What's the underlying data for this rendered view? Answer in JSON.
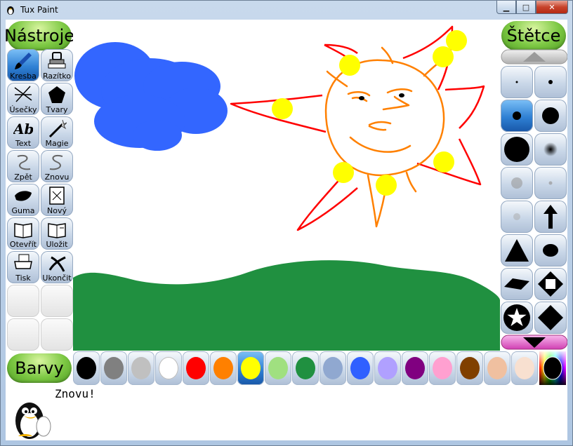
{
  "window": {
    "title": "Tux Paint"
  },
  "headers": {
    "tools": "Nástroje",
    "brushes": "Štětce",
    "colors": "Barvy"
  },
  "tools": [
    {
      "label": "Kresba",
      "icon": "paintbrush-icon",
      "selected": true
    },
    {
      "label": "Razítko",
      "icon": "stamp-icon"
    },
    {
      "label": "Úsečky",
      "icon": "lines-icon"
    },
    {
      "label": "Tvary",
      "icon": "pentagon-icon"
    },
    {
      "label": "Text",
      "icon": "text-icon"
    },
    {
      "label": "Magie",
      "icon": "magic-wand-icon"
    },
    {
      "label": "Zpět",
      "icon": "undo-icon"
    },
    {
      "label": "Znovu",
      "icon": "redo-icon"
    },
    {
      "label": "Guma",
      "icon": "eraser-icon"
    },
    {
      "label": "Nový",
      "icon": "new-page-icon"
    },
    {
      "label": "Otevřít",
      "icon": "open-book-icon"
    },
    {
      "label": "Uložit",
      "icon": "save-book-icon"
    },
    {
      "label": "Tisk",
      "icon": "printer-icon"
    },
    {
      "label": "Ukončit",
      "icon": "quit-icon"
    }
  ],
  "brushes": {
    "icons": [
      "dot-tiny-icon",
      "dot-small-icon",
      "dot-medium-icon",
      "dot-large-icon",
      "dot-xlarge-icon",
      "fuzzy-dot-icon",
      "soft-dot-icon",
      "soft-small-icon",
      "faint-dot-icon",
      "arrow-up-icon",
      "triangle-icon",
      "blob-icon",
      "diamond-flat-icon",
      "diamond-hollow-icon",
      "star-icon",
      "diamond-icon"
    ],
    "selected_index": 2
  },
  "colors": [
    {
      "name": "black",
      "hex": "#000000"
    },
    {
      "name": "dark-gray",
      "hex": "#808080"
    },
    {
      "name": "light-gray",
      "hex": "#c0c0c0"
    },
    {
      "name": "white",
      "hex": "#ffffff"
    },
    {
      "name": "red",
      "hex": "#ff0000"
    },
    {
      "name": "orange",
      "hex": "#ff8000"
    },
    {
      "name": "yellow",
      "hex": "#ffff00",
      "selected": true
    },
    {
      "name": "light-green",
      "hex": "#a0e080"
    },
    {
      "name": "green",
      "hex": "#209040"
    },
    {
      "name": "sky-blue",
      "hex": "#90a8d0"
    },
    {
      "name": "blue",
      "hex": "#3060ff"
    },
    {
      "name": "lavender",
      "hex": "#b0a0ff"
    },
    {
      "name": "purple",
      "hex": "#800080"
    },
    {
      "name": "pink",
      "hex": "#ffa0d0"
    },
    {
      "name": "brown",
      "hex": "#804000"
    },
    {
      "name": "tan",
      "hex": "#f0c0a0"
    },
    {
      "name": "beige",
      "hex": "#f8e0d0"
    }
  ],
  "status": {
    "message": "Znovu!"
  }
}
